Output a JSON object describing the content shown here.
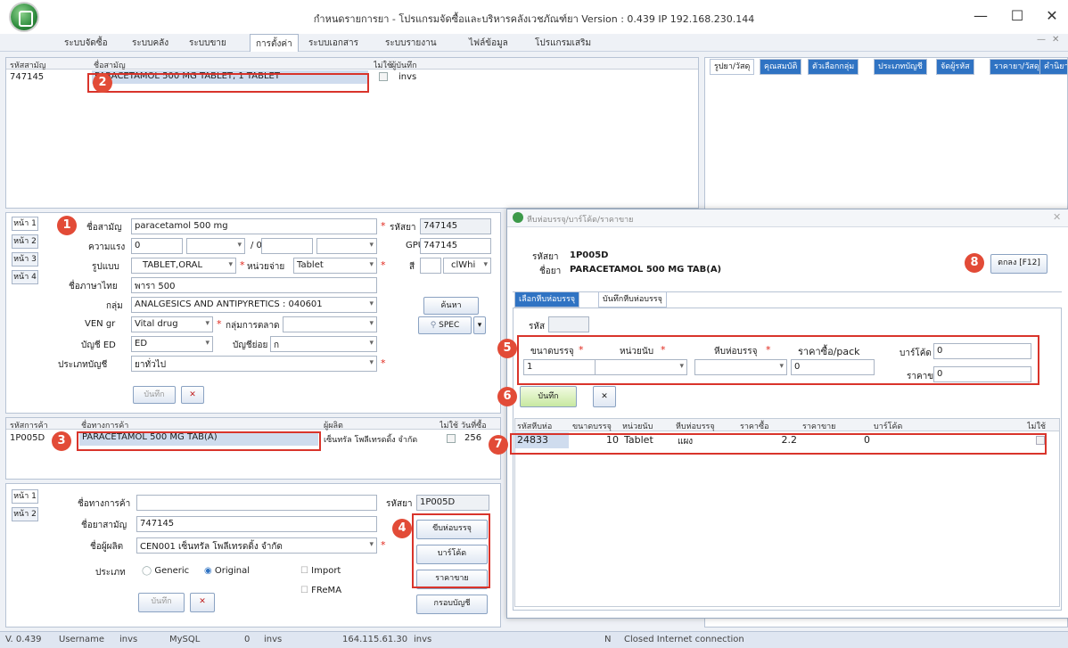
{
  "window": {
    "title": "กำหนดรายการยา - โปรแกรมจัดซื้อและบริหารคลังเวชภัณฑ์ยา Version : 0.439  IP 192.168.230.144",
    "minimize": "—",
    "maximize": "☐",
    "close": "✕"
  },
  "menu": {
    "items": [
      "ระบบจัดซื้อ",
      "ระบบคลัง",
      "ระบบขาย",
      "การตั้งค่า",
      "ระบบเอกสาร",
      "ระบบรายงาน",
      "ไฟล์ข้อมูล",
      "โปรแกรมเสริม"
    ],
    "active_index": 3,
    "sub_min": "—",
    "sub_close": "✕"
  },
  "drug_grid": {
    "headers": [
      "รหัสสามัญ",
      "ชื่อสามัญ",
      "ไม่ใช้",
      "ผู้บันทึก"
    ],
    "rows": [
      {
        "code": "747145",
        "name": "PARACETAMOL 500 MG TABLET, 1 TABLET",
        "recorder": "invs"
      }
    ]
  },
  "right_tabs": [
    "รูปยา/วัสดุ",
    "คุณสมบัติ",
    "ตัวเลือกกลุ่ม",
    "ประเภทบัญชี",
    "จัดผู้รหัส",
    "ราคายา/วัสดุ",
    "คำนิยาม"
  ],
  "generic_form": {
    "page_tabs": [
      "หน้า 1",
      "หน้า 2",
      "หน้า 3",
      "หน้า 4"
    ],
    "name_label": "ชื่อสามัญ",
    "name_value": "paracetamol 500 mg",
    "code_label": "รหัสยา",
    "code_value": "747145",
    "strength_label": "ความแรง",
    "strength_value": "0",
    "strength_sep": "/ 0",
    "gpu_label": "GPU",
    "gpu_value": "747145",
    "form_label": "รูปแบบ",
    "form_value": "TABLET,ORAL",
    "unit_label": "หน่วยจ่าย",
    "unit_value": "Tablet",
    "color_label": "สี",
    "color_value": "clWhi",
    "thai_label": "ชื่อภาษาไทย",
    "thai_value": "พารา 500",
    "group_label": "กลุ่ม",
    "group_value": "ANALGESICS AND ANTIPYRETICS : 040601",
    "search_btn": "ค้นหา",
    "ven_label": "VEN gr",
    "ven_value": "Vital drug",
    "pharma_label": "กลุ่มการตลาด",
    "spec_btn": "SPEC",
    "ed_label": "บัญชี ED",
    "ed_value": "ED",
    "ed_sub_label": "บัญชีย่อย",
    "ed_sub_value": "ก",
    "acct_label": "ประเภทบัญชี",
    "acct_value": "ยาทั่วไป",
    "save_btn": "บันทึก",
    "cancel_btn": "✕"
  },
  "trade_grid": {
    "headers": [
      "รหัสการค้า",
      "ชื่อทางการค้า",
      "ผู้ผลิต",
      "ไม่ใช้",
      "วันที่ซื้อ"
    ],
    "rows": [
      {
        "code": "1P005D",
        "name": "PARACETAMOL 500 MG TAB(A)",
        "mfr": "เซ็นทรัล โพลีเทรดดิ้ง จำกัด",
        "date": "256"
      }
    ]
  },
  "trade_form": {
    "page_tabs": [
      "หน้า 1",
      "หน้า 2"
    ],
    "trade_label": "ชื่อทางการค้า",
    "code_label": "รหัสยา",
    "code_value": "1P005D",
    "generic_label": "ชื่อยาสามัญ",
    "generic_value": "747145",
    "mfr_label": "ชื่อผู้ผลิต",
    "mfr_value": "CEN001 เซ็นทรัล โพลีเทรดดิ้ง จำกัด",
    "type_label": "ประเภท",
    "generic_opt": "Generic",
    "original_opt": "Original",
    "import_opt": "Import",
    "frema_opt": "FReMA",
    "pack_btn": "ขีบห่อบรรจุ",
    "barcode_btn": "บาร์โค้ด",
    "price_btn": "ราคาขาย",
    "acct_btn": "กรอบบัญชี",
    "save_btn": "บันทึก",
    "cancel_btn": "✕"
  },
  "dialog": {
    "title": "หีบห่อบรรจุ/บาร์โค้ด/ราคาขาย",
    "code_label": "รหัสยา",
    "code_value": "1P005D",
    "name_label": "ชื่อยา",
    "name_value": "PARACETAMOL 500 MG TAB(A)",
    "close_btn": "ตกลง [F12]",
    "tabs": [
      "เลือกหีบห่อบรรจุ",
      "บันทึกหีบห่อบรรจุ"
    ],
    "field_code_label": "รหัส",
    "size_label": "ขนาดบรรจุ",
    "size_value": "1",
    "unit_label": "หน่วยนับ",
    "pack_label": "หีบห่อบรรจุ",
    "pack_value": "0",
    "price_label": "ราคาซื้อ/pack",
    "barcode_label": "บาร์โค้ด",
    "barcode_value": "0",
    "sell_label": "ราคาขาย",
    "sell_value": "0",
    "save_btn": "บันทึก",
    "cancel_btn": "✕",
    "grid_headers": [
      "รหัสหีบห่อ",
      "ขนาดบรรจุ",
      "หน่วยนับ",
      "หีบห่อบรรจุ",
      "ราคาซื้อ",
      "ราคาขาย",
      "บาร์โค้ด",
      "ไม่ใช้"
    ],
    "grid_rows": [
      {
        "code": "24833",
        "size": "10",
        "unit": "Tablet",
        "pack": "แผง",
        "buy": "2.2",
        "sell": "0",
        "barcode": ""
      }
    ]
  },
  "badges": [
    "1",
    "2",
    "3",
    "4",
    "5",
    "6",
    "7",
    "8"
  ],
  "status": {
    "version": "V. 0.439",
    "user_label": "Username",
    "user": "invs",
    "db": "MySQL",
    "num": "0",
    "user2": "invs",
    "ip": "164.115.61.30",
    "user3": "invs",
    "n": "N",
    "conn": "Closed Internet connection"
  },
  "colors": {
    "accent_red": "#d9342b",
    "badge": "#e24b37",
    "tab_blue": "#2f73c3"
  }
}
